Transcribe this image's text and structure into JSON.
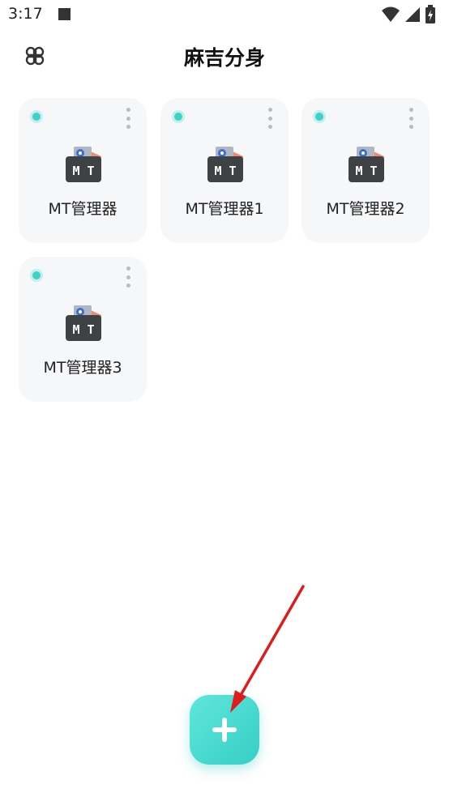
{
  "status_bar": {
    "time": "3:17",
    "icons": [
      "notification-square-icon",
      "wifi-icon",
      "signal-icon",
      "battery-charging-icon"
    ]
  },
  "header": {
    "title": "麻吉分身",
    "menu_icon": "clover-menu-icon"
  },
  "apps": [
    {
      "name": "MT管理器",
      "icon": "mt-manager-icon",
      "status_color": "#3bd4c6"
    },
    {
      "name": "MT管理器1",
      "icon": "mt-manager-icon",
      "status_color": "#3bd4c6"
    },
    {
      "name": "MT管理器2",
      "icon": "mt-manager-icon",
      "status_color": "#3bd4c6"
    },
    {
      "name": "MT管理器3",
      "icon": "mt-manager-icon",
      "status_color": "#3bd4c6"
    }
  ],
  "fab": {
    "icon": "plus-icon",
    "color": "#45d9ce"
  },
  "annotation": {
    "icon": "red-arrow-icon",
    "color": "#e01b1b"
  },
  "colors": {
    "accent": "#3bd4c6",
    "card_bg": "#f6f7f9"
  }
}
